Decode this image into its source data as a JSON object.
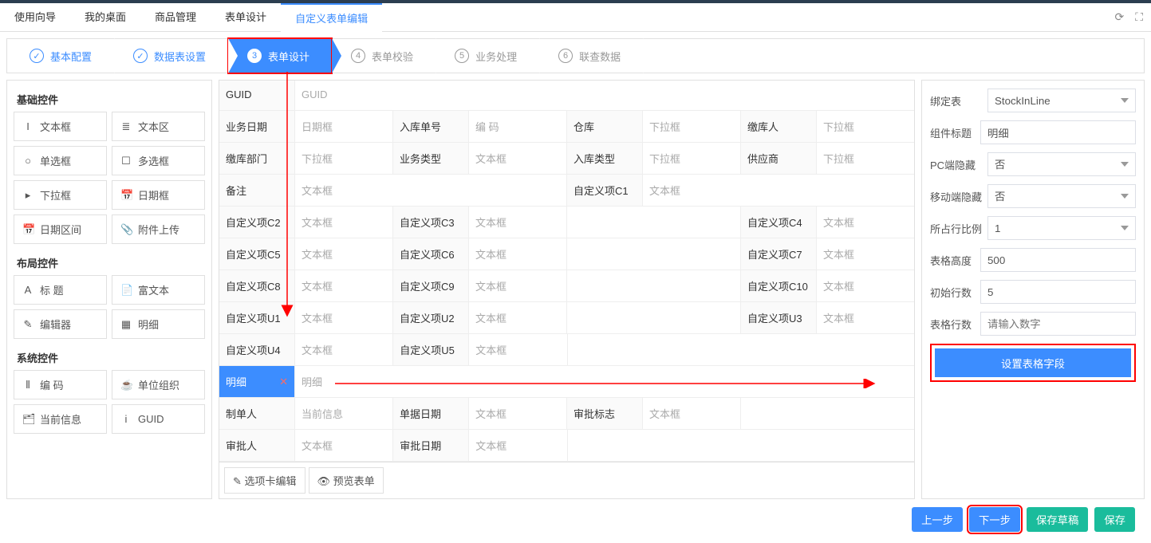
{
  "tabs": {
    "items": [
      "使用向导",
      "我的桌面",
      "商品管理",
      "表单设计",
      "自定义表单编辑"
    ],
    "active": 4
  },
  "steps": {
    "items": [
      {
        "num": "",
        "label": "基本配置",
        "state": "done"
      },
      {
        "num": "",
        "label": "数据表设置",
        "state": "done"
      },
      {
        "num": "3",
        "label": "表单设计",
        "state": "active"
      },
      {
        "num": "4",
        "label": "表单校验",
        "state": ""
      },
      {
        "num": "5",
        "label": "业务处理",
        "state": ""
      },
      {
        "num": "6",
        "label": "联查数据",
        "state": ""
      }
    ]
  },
  "sidebar": {
    "sections": [
      {
        "title": "基础控件",
        "items": [
          {
            "icon": "I",
            "label": "文本框"
          },
          {
            "icon": "≣",
            "label": "文本区"
          },
          {
            "icon": "○",
            "label": "单选框"
          },
          {
            "icon": "☐",
            "label": "多选框"
          },
          {
            "icon": "▸",
            "label": "下拉框"
          },
          {
            "icon": "📅",
            "label": "日期框"
          },
          {
            "icon": "📅",
            "label": "日期区间"
          },
          {
            "icon": "📎",
            "label": "附件上传"
          }
        ]
      },
      {
        "title": "布局控件",
        "items": [
          {
            "icon": "A",
            "label": "标 题"
          },
          {
            "icon": "📄",
            "label": "富文本"
          },
          {
            "icon": "✎",
            "label": "编辑器"
          },
          {
            "icon": "▦",
            "label": "明细"
          }
        ]
      },
      {
        "title": "系统控件",
        "items": [
          {
            "icon": "⦀",
            "label": "编 码"
          },
          {
            "icon": "☕",
            "label": "单位组织"
          },
          {
            "icon": "🗂",
            "label": "当前信息"
          },
          {
            "icon": "i",
            "label": "GUID"
          }
        ]
      }
    ]
  },
  "form_rows": [
    [
      {
        "label": "GUID",
        "ctrl": "GUID",
        "span": 4
      }
    ],
    [
      {
        "label": "业务日期",
        "ctrl": "日期框"
      },
      {
        "label": "入库单号",
        "ctrl": "编 码"
      },
      {
        "label": "仓库",
        "ctrl": "下拉框"
      },
      {
        "label": "缴库人",
        "ctrl": "下拉框"
      }
    ],
    [
      {
        "label": "缴库部门",
        "ctrl": "下拉框"
      },
      {
        "label": "业务类型",
        "ctrl": "文本框"
      },
      {
        "label": "入库类型",
        "ctrl": "下拉框"
      },
      {
        "label": "供应商",
        "ctrl": "下拉框"
      }
    ],
    [
      {
        "label": "备注",
        "ctrl": "文本框",
        "span": 2
      },
      {
        "label": "自定义项C1",
        "ctrl": "文本框",
        "span": 2
      }
    ],
    [
      {
        "label": "自定义项C2",
        "ctrl": "文本框"
      },
      {
        "label": "自定义项C3",
        "ctrl": "文本框"
      },
      {
        "label": "",
        "ctrl": ""
      },
      {
        "label": "自定义项C4",
        "ctrl": "文本框"
      }
    ],
    [
      {
        "label": "自定义项C5",
        "ctrl": "文本框"
      },
      {
        "label": "自定义项C6",
        "ctrl": "文本框"
      },
      {
        "label": "",
        "ctrl": ""
      },
      {
        "label": "自定义项C7",
        "ctrl": "文本框"
      }
    ],
    [
      {
        "label": "自定义项C8",
        "ctrl": "文本框"
      },
      {
        "label": "自定义项C9",
        "ctrl": "文本框"
      },
      {
        "label": "",
        "ctrl": ""
      },
      {
        "label": "自定义项C10",
        "ctrl": "文本框"
      }
    ],
    [
      {
        "label": "自定义项U1",
        "ctrl": "文本框"
      },
      {
        "label": "自定义项U2",
        "ctrl": "文本框"
      },
      {
        "label": "",
        "ctrl": ""
      },
      {
        "label": "自定义项U3",
        "ctrl": "文本框"
      }
    ],
    [
      {
        "label": "自定义项U4",
        "ctrl": "文本框"
      },
      {
        "label": "自定义项U5",
        "ctrl": "文本框"
      },
      {
        "label": "",
        "ctrl": "",
        "span": 2
      }
    ],
    [
      {
        "label": "明细",
        "ctrl": "明细",
        "span": 4,
        "selected": true
      }
    ],
    [
      {
        "label": "制单人",
        "ctrl": "当前信息"
      },
      {
        "label": "单据日期",
        "ctrl": "文本框"
      },
      {
        "label": "审批标志",
        "ctrl": "文本框"
      },
      {
        "label": "",
        "ctrl": ""
      }
    ],
    [
      {
        "label": "审批人",
        "ctrl": "文本框"
      },
      {
        "label": "审批日期",
        "ctrl": "文本框"
      },
      {
        "label": "",
        "ctrl": "",
        "span": 2
      }
    ]
  ],
  "canvas_footer": {
    "tab_edit": "选项卡编辑",
    "preview": "预览表单"
  },
  "right": {
    "bind_table": {
      "label": "绑定表",
      "value": "StockInLine"
    },
    "component_title": {
      "label": "组件标题",
      "value": "明细"
    },
    "pc_hide": {
      "label": "PC端隐藏",
      "value": "否"
    },
    "mobile_hide": {
      "label": "移动端隐藏",
      "value": "否"
    },
    "row_ratio": {
      "label": "所占行比例",
      "value": "1"
    },
    "table_height": {
      "label": "表格高度",
      "value": "500"
    },
    "init_rows": {
      "label": "初始行数",
      "value": "5"
    },
    "table_rows": {
      "label": "表格行数",
      "value": "",
      "placeholder": "请输入数字"
    },
    "set_cols_btn": "设置表格字段"
  },
  "bottom": {
    "prev": "上一步",
    "next": "下一步",
    "save_draft": "保存草稿",
    "save": "保存"
  }
}
